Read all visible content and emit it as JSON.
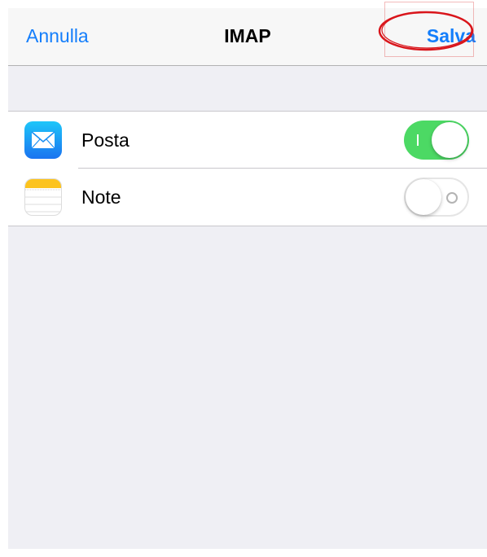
{
  "navbar": {
    "cancel_label": "Annulla",
    "title": "IMAP",
    "save_label": "Salva"
  },
  "accent_color": "#147efb",
  "toggle_on_color": "#4cd964",
  "highlight_color": "#d9151b",
  "services": [
    {
      "label": "Posta",
      "icon": "mail-icon",
      "enabled": true
    },
    {
      "label": "Note",
      "icon": "notes-icon",
      "enabled": false
    }
  ]
}
